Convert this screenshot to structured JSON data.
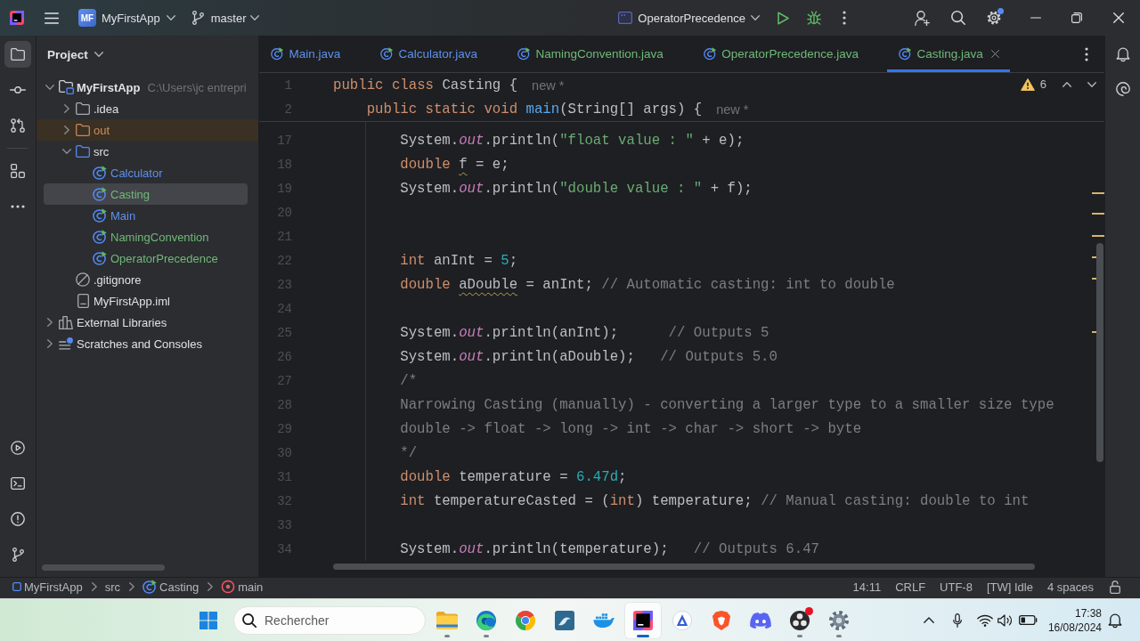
{
  "title_bar": {
    "project_badge": "MF",
    "project": "MyFirstApp",
    "branch": "master",
    "run_configuration": "OperatorPrecedence",
    "settings_update": true
  },
  "tool_strip": {
    "top_groups": [
      [
        {
          "kind": "project",
          "selected": true
        },
        {
          "kind": "commit",
          "selected": false
        },
        {
          "kind": "pull-requests",
          "selected": false
        }
      ],
      [
        {
          "kind": "structure",
          "selected": false
        },
        {
          "kind": "more",
          "selected": false
        }
      ]
    ],
    "bottom": [
      {
        "kind": "run",
        "selected": false
      },
      {
        "kind": "terminal",
        "selected": false
      },
      {
        "kind": "problems",
        "selected": false
      },
      {
        "kind": "git",
        "selected": false
      }
    ]
  },
  "project_panel": {
    "title": "Project",
    "tree": [
      {
        "label": "MyFirstApp",
        "path": "C:\\Users\\jc entrepri",
        "kind": "module",
        "color": "#dfe1e5",
        "expanded": true,
        "selected": false,
        "children": [
          {
            "label": ".idea",
            "kind": "folder",
            "color": "#dfe1e5",
            "expanded": false,
            "selected": false
          },
          {
            "label": "out",
            "kind": "excluded-folder",
            "color": "#d08c58",
            "expanded": false,
            "selected": false
          },
          {
            "label": "src",
            "kind": "source-folder",
            "color": "#dfe1e5",
            "expanded": true,
            "selected": false,
            "children": [
              {
                "label": "Calculator",
                "kind": "class",
                "color": "#5e90ec",
                "selected": false
              },
              {
                "label": "Casting",
                "kind": "class",
                "color": "#6fb878",
                "selected": true
              },
              {
                "label": "Main",
                "kind": "class",
                "color": "#5e90ec",
                "selected": false
              },
              {
                "label": "NamingConvention",
                "kind": "class",
                "color": "#6fb878",
                "selected": false
              },
              {
                "label": "OperatorPrecedence",
                "kind": "class",
                "color": "#6fb878",
                "selected": false
              }
            ]
          },
          {
            "label": ".gitignore",
            "kind": "ignore-file",
            "color": "#dfe1e5",
            "selected": false
          },
          {
            "label": "MyFirstApp.iml",
            "kind": "file",
            "color": "#dfe1e5",
            "selected": false
          }
        ]
      },
      {
        "label": "External Libraries",
        "kind": "library",
        "color": "#dfe1e5",
        "expanded": false,
        "selected": false
      },
      {
        "label": "Scratches and Consoles",
        "kind": "scratches",
        "color": "#dfe1e5",
        "expanded": false,
        "selected": false
      }
    ]
  },
  "editor": {
    "tabs": [
      {
        "label": "Main.java",
        "color": "#5e90ec",
        "selected": false
      },
      {
        "label": "Calculator.java",
        "color": "#5e90ec",
        "selected": false
      },
      {
        "label": "NamingConvention.java",
        "color": "#6fb878",
        "selected": false
      },
      {
        "label": "OperatorPrecedence.java",
        "color": "#6fb878",
        "selected": false
      },
      {
        "label": "Casting.java",
        "color": "#6fb878",
        "selected": true
      }
    ],
    "warning_count": "6",
    "sticky_lines": [
      {
        "number": "1",
        "tokens": [
          {
            "text": "public class",
            "kind": "keyword"
          },
          {
            "text": " Casting {",
            "kind": "plain"
          }
        ],
        "hint": "new *",
        "children": [
          {
            "number": "2",
            "tokens": [
              {
                "text": "public static void ",
                "kind": "keyword"
              },
              {
                "text": "main",
                "kind": "method"
              },
              {
                "text": "(String[] args) {",
                "kind": "plain"
              }
            ],
            "hint": "new *"
          }
        ]
      }
    ],
    "lines": [
      {
        "number": "17",
        "tokens": [
          {
            "text": "System.",
            "kind": "plain"
          },
          {
            "text": "out",
            "kind": "field"
          },
          {
            "text": ".println(",
            "kind": "plain"
          },
          {
            "text": "\"float value : \"",
            "kind": "string"
          },
          {
            "text": " + e);",
            "kind": "plain"
          }
        ]
      },
      {
        "number": "18",
        "tokens": [
          {
            "text": "double ",
            "kind": "keyword"
          },
          {
            "text": "f",
            "kind": "warned"
          },
          {
            "text": " = e;",
            "kind": "plain"
          }
        ]
      },
      {
        "number": "19",
        "tokens": [
          {
            "text": "System.",
            "kind": "plain"
          },
          {
            "text": "out",
            "kind": "field"
          },
          {
            "text": ".println(",
            "kind": "plain"
          },
          {
            "text": "\"double value : \"",
            "kind": "string"
          },
          {
            "text": " + f);",
            "kind": "plain"
          }
        ]
      },
      {
        "number": "20"
      },
      {
        "number": "21"
      },
      {
        "number": "22",
        "tokens": [
          {
            "text": "int",
            "kind": "keyword"
          },
          {
            "text": " anInt = ",
            "kind": "plain"
          },
          {
            "text": "5",
            "kind": "number"
          },
          {
            "text": ";",
            "kind": "plain"
          }
        ]
      },
      {
        "number": "23",
        "tokens": [
          {
            "text": "double ",
            "kind": "keyword"
          },
          {
            "text": "aDouble",
            "kind": "warned"
          },
          {
            "text": " = anInt; ",
            "kind": "plain"
          },
          {
            "text": "// Automatic casting: int to double",
            "kind": "comment"
          }
        ]
      },
      {
        "number": "24"
      },
      {
        "number": "25",
        "tokens": [
          {
            "text": "System.",
            "kind": "plain"
          },
          {
            "text": "out",
            "kind": "field"
          },
          {
            "text": ".println(anInt);      ",
            "kind": "plain"
          },
          {
            "text": "// Outputs 5",
            "kind": "comment"
          }
        ]
      },
      {
        "number": "26",
        "tokens": [
          {
            "text": "System.",
            "kind": "plain"
          },
          {
            "text": "out",
            "kind": "field"
          },
          {
            "text": ".println(aDouble);   ",
            "kind": "plain"
          },
          {
            "text": "// Outputs 5.0",
            "kind": "comment"
          }
        ]
      },
      {
        "number": "27",
        "tokens": [
          {
            "text": "/*",
            "kind": "comment"
          }
        ]
      },
      {
        "number": "28",
        "tokens": [
          {
            "text": "Narrowing Casting (manually) - converting a larger type to a smaller size type",
            "kind": "comment"
          }
        ]
      },
      {
        "number": "29",
        "tokens": [
          {
            "text": "double -> float -> long -> int -> char -> short -> byte",
            "kind": "comment"
          }
        ]
      },
      {
        "number": "30",
        "tokens": [
          {
            "text": "*/",
            "kind": "comment"
          }
        ]
      },
      {
        "number": "31",
        "tokens": [
          {
            "text": "double",
            "kind": "keyword"
          },
          {
            "text": " temperature = ",
            "kind": "plain"
          },
          {
            "text": "6.47d",
            "kind": "number"
          },
          {
            "text": ";",
            "kind": "plain"
          }
        ]
      },
      {
        "number": "32",
        "tokens": [
          {
            "text": "int",
            "kind": "keyword"
          },
          {
            "text": " temperatureCasted = (",
            "kind": "plain"
          },
          {
            "text": "int",
            "kind": "keyword"
          },
          {
            "text": ") temperature; ",
            "kind": "plain"
          },
          {
            "text": "// Manual casting: double to int",
            "kind": "comment"
          }
        ]
      },
      {
        "number": "33"
      },
      {
        "number": "34",
        "tokens": [
          {
            "text": "System.",
            "kind": "plain"
          },
          {
            "text": "out",
            "kind": "field"
          },
          {
            "text": ".println(temperature);   ",
            "kind": "plain"
          },
          {
            "text": "// Outputs 6.47",
            "kind": "comment"
          }
        ]
      }
    ]
  },
  "status_bar": {
    "breadcrumbs": [
      {
        "label": "MyFirstApp",
        "kind": "module"
      },
      {
        "label": "src",
        "kind": "folder"
      },
      {
        "label": "Casting",
        "kind": "class"
      },
      {
        "label": "main",
        "kind": "method"
      }
    ],
    "cursor_position": "14:11",
    "line_separator": "CRLF",
    "encoding": "UTF-8",
    "language_status": "[TW] Idle",
    "indentation": "4 spaces"
  },
  "taskbar": {
    "search": {
      "placeholder": "Rechercher"
    },
    "apps": [
      {
        "kind": "explorer",
        "running": true,
        "selected": false,
        "notification": false
      },
      {
        "kind": "edge",
        "running": true,
        "selected": false,
        "notification": false
      },
      {
        "kind": "chrome",
        "running": false,
        "selected": false,
        "notification": false
      },
      {
        "kind": "workbench",
        "running": false,
        "selected": false,
        "notification": false
      },
      {
        "kind": "docker",
        "running": false,
        "selected": false,
        "notification": false
      },
      {
        "kind": "intellij",
        "running": true,
        "selected": true,
        "notification": false
      },
      {
        "kind": "assistant",
        "running": false,
        "selected": false,
        "notification": false
      },
      {
        "kind": "brave",
        "running": false,
        "selected": false,
        "notification": false
      },
      {
        "kind": "discord",
        "running": false,
        "selected": false,
        "notification": false
      },
      {
        "kind": "obs",
        "running": true,
        "selected": false,
        "notification": true
      },
      {
        "kind": "settings",
        "running": true,
        "selected": false,
        "notification": false
      }
    ],
    "time": "17:38",
    "date": "16/08/2024"
  }
}
